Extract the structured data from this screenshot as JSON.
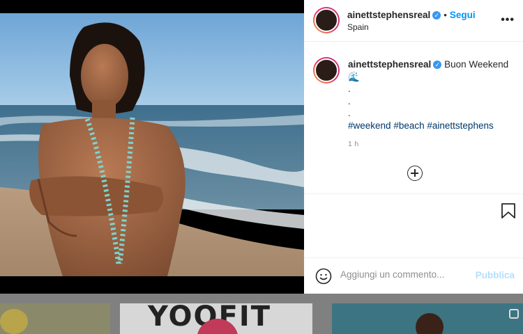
{
  "post": {
    "username": "ainettstephensreal",
    "follow_label": "Segui",
    "separator": "•",
    "location": "Spain",
    "more_label": "•••",
    "verified_mark": "✓"
  },
  "caption": {
    "username": "ainettstephensreal",
    "text": "Buon Weekend 🌊",
    "dots": [
      ".",
      ".",
      "."
    ],
    "hashtags": [
      "#weekend",
      "#beach",
      "#ainettstephens"
    ],
    "time": "1 h"
  },
  "comment": {
    "placeholder": "Aggiungi un commento...",
    "publish_label": "Pubblica"
  },
  "background_grid": {
    "middle_thumb_text": "YOOFIT"
  },
  "colors": {
    "accent": "#0095f6",
    "publish_disabled": "#b2dffc",
    "hashtag": "#00376b",
    "text": "#262626",
    "muted": "#8e8e8e"
  },
  "icons": [
    "verified-badge-icon",
    "more-options-icon",
    "add-circle-icon",
    "bookmark-icon",
    "emoji-icon",
    "multiple-posts-icon"
  ]
}
